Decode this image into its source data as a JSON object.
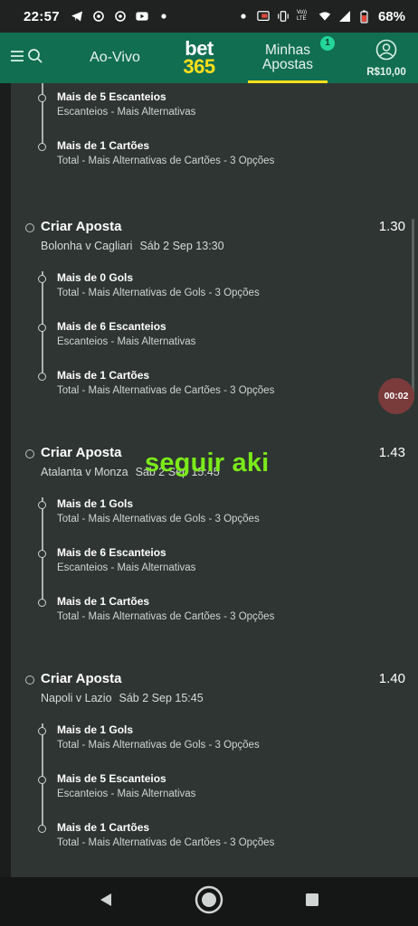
{
  "status_bar": {
    "time": "22:57",
    "battery": "68%",
    "left_icons": [
      "telegram-icon",
      "app-icon",
      "app-icon",
      "youtube-icon",
      "dot-icon"
    ],
    "right_icons": [
      "dot-icon",
      "cast-icon",
      "vibrate-icon",
      "volte-icon",
      "wifi-icon",
      "signal-icon",
      "battery-icon"
    ],
    "volte_label": "Vo)) LTE"
  },
  "header": {
    "live_label": "Ao-Vivo",
    "logo_line1": "bet",
    "logo_line2": "365",
    "my_bets_line1": "Minhas",
    "my_bets_line2": "Apostas",
    "my_bets_badge": "1",
    "balance": "R$10,00"
  },
  "cards": [
    {
      "partial": true,
      "legs": [
        {
          "name": "Mais de 5 Escanteios",
          "market": "Escanteios - Mais Alternativas"
        },
        {
          "name": "Mais de 1 Cartões",
          "market": "Total - Mais Alternativas de Cartões - 3 Opções"
        }
      ]
    },
    {
      "title": "Criar Aposta",
      "odds": "1.30",
      "match": "Bolonha v Cagliari",
      "date": "Sáb 2 Sep 13:30",
      "legs": [
        {
          "name": "Mais de 0 Gols",
          "market": "Total - Mais Alternativas de Gols - 3 Opções"
        },
        {
          "name": "Mais de 6 Escanteios",
          "market": "Escanteios - Mais Alternativas"
        },
        {
          "name": "Mais de 1 Cartões",
          "market": "Total - Mais Alternativas de Cartões - 3 Opções"
        }
      ]
    },
    {
      "title": "Criar Aposta",
      "odds": "1.43",
      "match": "Atalanta v Monza",
      "date": "Sáb 2 Sep 15:45",
      "legs": [
        {
          "name": "Mais de 1 Gols",
          "market": "Total - Mais Alternativas de Gols - 3 Opções"
        },
        {
          "name": "Mais de 6 Escanteios",
          "market": "Escanteios - Mais Alternativas"
        },
        {
          "name": "Mais de 1 Cartões",
          "market": "Total - Mais Alternativas de Cartões - 3 Opções"
        }
      ]
    },
    {
      "title": "Criar Aposta",
      "odds": "1.40",
      "match": "Napoli v Lazio",
      "date": "Sáb 2 Sep 15:45",
      "legs": [
        {
          "name": "Mais de 1 Gols",
          "market": "Total - Mais Alternativas de Gols - 3 Opções"
        },
        {
          "name": "Mais de 5 Escanteios",
          "market": "Escanteios - Mais Alternativas"
        },
        {
          "name": "Mais de 1 Cartões",
          "market": "Total - Mais Alternativas de Cartões - 3 Opções"
        }
      ]
    }
  ],
  "overlay": {
    "caption": "seguir aki",
    "timer": "00:02"
  },
  "nav": {
    "icons": [
      "back-icon",
      "home-icon",
      "recents-icon"
    ]
  },
  "colors": {
    "header_bg": "#126e51",
    "accent_yellow": "#ffdf1b",
    "badge": "#25d69a",
    "overlay_text": "#7bea1a",
    "content_bg": "#2e3532"
  }
}
